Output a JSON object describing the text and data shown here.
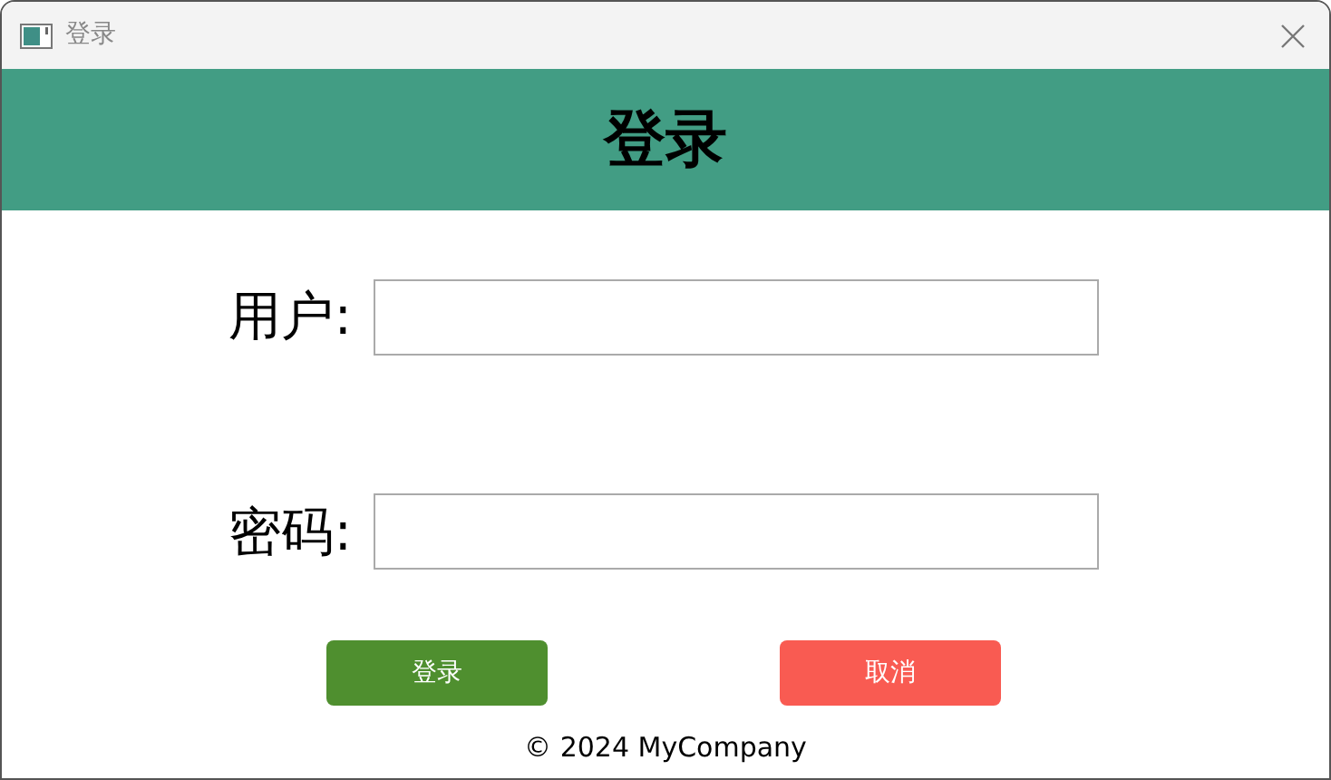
{
  "window": {
    "title": "登录"
  },
  "header": {
    "title": "登录"
  },
  "fields": [
    {
      "label": "用户:"
    },
    {
      "label": "密码:"
    }
  ],
  "buttons": [
    {
      "label": "登录",
      "kind": "primary"
    },
    {
      "label": "取消",
      "kind": "danger"
    }
  ],
  "footer": "© 2024 MyCompany"
}
